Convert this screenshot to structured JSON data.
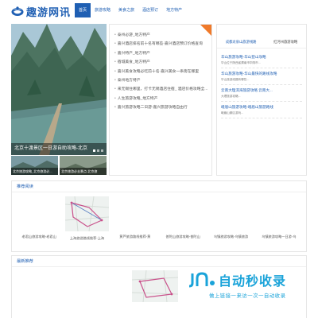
{
  "site": {
    "name": "趣游网讯",
    "brand_color": "#1f5fb3"
  },
  "nav": {
    "items": [
      {
        "label": "首页",
        "active": true
      },
      {
        "label": "旅游攻略",
        "active": false
      },
      {
        "label": "美食之旅",
        "active": false
      },
      {
        "label": "酒店预订",
        "active": false
      },
      {
        "label": "地方特产",
        "active": false
      }
    ]
  },
  "slider": {
    "caption": "北京十渡景区一日游自助攻略-北京",
    "thumbs": [
      {
        "caption": "北京旅游攻略_北京旅游必..."
      },
      {
        "caption": "北京旅游必去景点-北京旅"
      }
    ]
  },
  "news": {
    "items": [
      "泰州必游_地方特产",
      "嘉兴酒店排名前十名有哪些-嘉兴酒店预订价格查询",
      "嘉兴特产_地方特产",
      "宿城美食_地方特产",
      "嘉兴美食攻略必吃前十名-嘉兴美食一条街在哪里",
      "泰州地方特产",
      "来无锡住哪里，打卡无锡酒店住宿_ 酒店价格攻略全...",
      "人生旅游攻略_地方特产",
      "嘉兴旅游攻略二日游-嘉兴旅游攻略自由行"
    ]
  },
  "sidebar": {
    "tabs": [
      "成都龙泉山旅游线路",
      "红河州旅游攻略"
    ],
    "items": [
      {
        "title": "华山旅游攻略-华山登山攻略",
        "sub": "华山位于陕西省渭南市华阴市..."
      },
      {
        "title": "华山旅游攻略-华山最快的路线攻略",
        "sub": "华山旅游线路有哪些..."
      },
      {
        "title": "云南大理洱海旅游攻略 云南大...",
        "sub": "大理旅游攻略..."
      },
      {
        "title": "峨眉山旅游攻略-峨眉山旅游路线",
        "sub": "峨眉山景区游玩..."
      }
    ]
  },
  "recommend": {
    "title": "推荐阅读",
    "items": [
      "老君山旅游攻略-老君山",
      "上海旅游路线推荐-上海",
      "黄芦旅游路线推荐-黄",
      "普陀山旅游攻略-普陀山",
      "乌镇旅游攻略-乌镇旅游",
      "乌镇旅游攻略一日游-乌"
    ]
  },
  "latest": {
    "title": "最新推荐"
  },
  "watermark": {
    "main": "自动秒收录",
    "sub": "做上链接一来访一次一自动收录"
  }
}
